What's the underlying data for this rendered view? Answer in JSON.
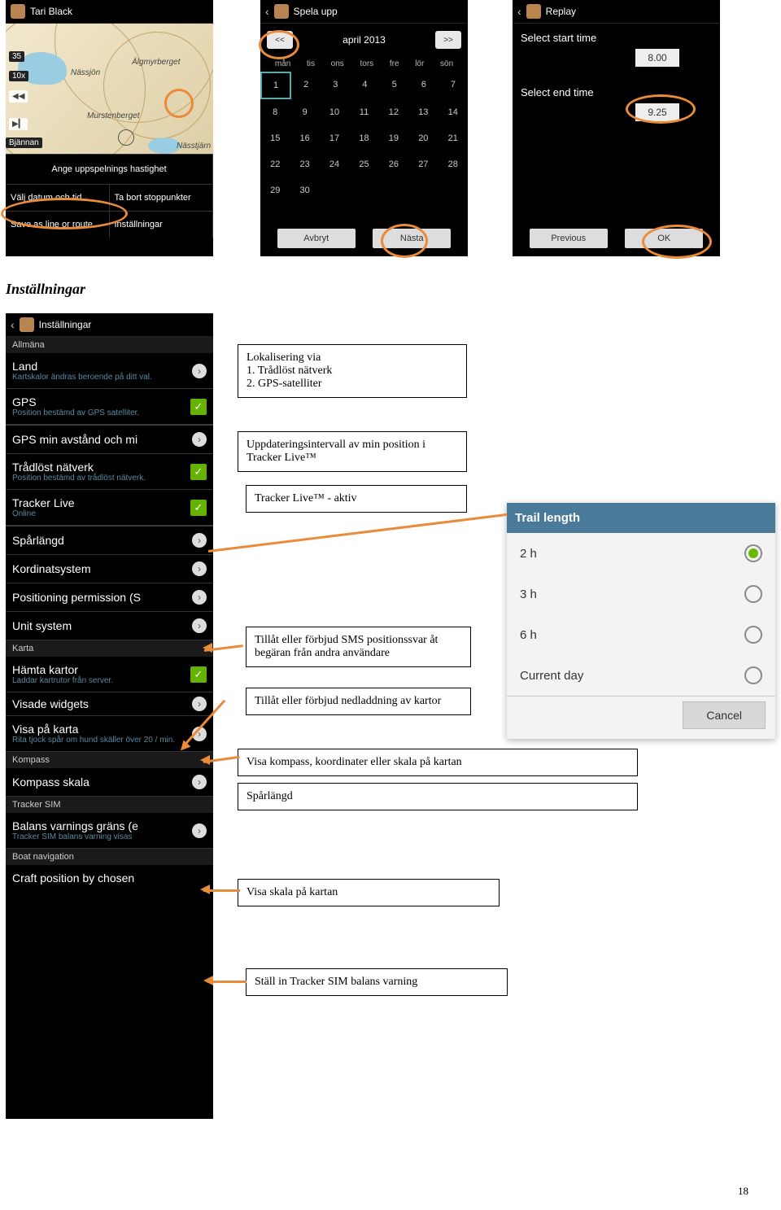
{
  "page_number": "18",
  "section_title": "Inställningar",
  "phone1": {
    "title": "Tari Black",
    "map_labels": {
      "nassjon": "Nässjön",
      "algmyr": "Älgmyrberget",
      "mursten": "Murstenberget",
      "nasstjarn": "Nässtjärn"
    },
    "badge_35": "35",
    "badge_10x": "10x",
    "badge_brannan": "Bjännan",
    "row1": "Ange uppspelnings hastighet",
    "row2a": "Välj datum och tid",
    "row2b": "Ta bort stoppunkter",
    "row3a": "Save as line or route",
    "row3b": "Inställningar"
  },
  "phone2": {
    "title": "Spela upp",
    "prev": "<<",
    "next": ">>",
    "month": "april 2013",
    "days": [
      "mån",
      "tis",
      "ons",
      "tors",
      "fre",
      "lör",
      "sön"
    ],
    "weeks": [
      [
        "1",
        "2",
        "3",
        "4",
        "5",
        "6",
        "7"
      ],
      [
        "8",
        "9",
        "10",
        "11",
        "12",
        "13",
        "14"
      ],
      [
        "15",
        "16",
        "17",
        "18",
        "19",
        "20",
        "21"
      ],
      [
        "22",
        "23",
        "24",
        "25",
        "26",
        "27",
        "28"
      ],
      [
        "29",
        "30",
        "",
        "",
        "",
        "",
        ""
      ]
    ],
    "cancel": "Avbryt",
    "next_btn": "Nästa"
  },
  "phone3": {
    "title": "Replay",
    "start_label": "Select start time",
    "end_label": "Select end time",
    "start_val": "8.00",
    "end_val": "9.25",
    "prev": "Previous",
    "ok": "OK"
  },
  "settings": {
    "hdr": "Inställningar",
    "cat1": "Allmäna",
    "land": {
      "t": "Land",
      "s": "Kartskalor ändras beroende på ditt val."
    },
    "gps": {
      "t": "GPS",
      "s": "Position bestämd av GPS satelliter."
    },
    "gpsmin": {
      "t": "GPS min avstånd och mi"
    },
    "wifi": {
      "t": "Trådlöst nätverk",
      "s": "Position bestämd av trådlöst nätverk."
    },
    "tracker": {
      "t": "Tracker Live",
      "s": "Online"
    },
    "trail": {
      "t": "Spårlängd"
    },
    "coord": {
      "t": "Kordinatsystem"
    },
    "pos": {
      "t": "Positioning permission (S"
    },
    "unit": {
      "t": "Unit system"
    },
    "cat2": "Karta",
    "hamta": {
      "t": "Hämta kartor",
      "s": "Laddar kartrutor från server."
    },
    "widgets": {
      "t": "Visade widgets"
    },
    "visa": {
      "t": "Visa på karta",
      "s": "Rita tjock spår om hund skäller över 20 / min."
    },
    "cat3": "Kompass",
    "kompass": {
      "t": "Kompass skala"
    },
    "cat4": "Tracker SIM",
    "balans": {
      "t": "Balans varnings gräns (e",
      "s": "Tracker SIM balans varning visas"
    },
    "cat5": "Boat navigation",
    "craft": {
      "t": "Craft position by chosen"
    }
  },
  "dialog": {
    "title": "Trail length",
    "opts": [
      "2 h",
      "3 h",
      "6 h",
      "Current day"
    ],
    "cancel": "Cancel"
  },
  "annot": {
    "a1_title": "Lokalisering via",
    "a1_l1": "1.  Trådlöst nätverk",
    "a1_l2": "2.  GPS-satelliter",
    "a2": "Uppdateringsintervall av min position i Tracker Live™",
    "a3": "Tracker Live™ - aktiv",
    "a4": "Tillåt eller förbjud SMS positionssvar åt begäran från andra användare",
    "a5": "Tillåt eller förbjud nedladdning av kartor",
    "a6": "Visa kompass, koordinater eller skala på kartan",
    "a7": "Spårlängd",
    "a8": "Visa skala på kartan",
    "a9": "Ställ in Tracker SIM balans varning"
  }
}
